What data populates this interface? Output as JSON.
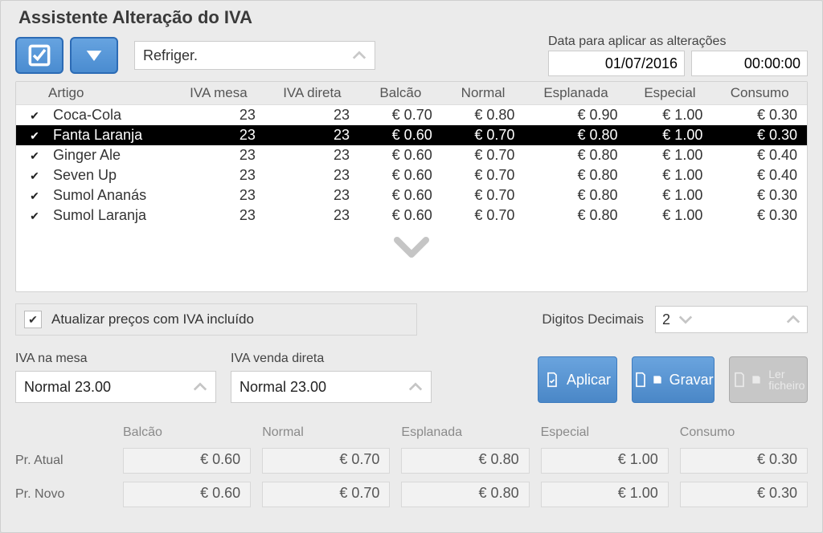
{
  "window": {
    "title": "Assistente Alteração do IVA"
  },
  "search": {
    "value": "Refriger."
  },
  "dateBlock": {
    "label": "Data para aplicar as alterações",
    "date": "01/07/2016",
    "time": "00:00:00"
  },
  "gridHeaders": {
    "artigo": "Artigo",
    "iva_mesa": "IVA mesa",
    "iva_direta": "IVA direta",
    "balcao": "Balcão",
    "normal": "Normal",
    "esplanada": "Esplanada",
    "especial": "Especial",
    "consumo": "Consumo"
  },
  "rows": [
    {
      "artigo": "Coca-Cola",
      "iva_mesa": "23",
      "iva_direta": "23",
      "balcao": "€ 0.70",
      "normal": "€ 0.80",
      "esplanada": "€ 0.90",
      "especial": "€ 1.00",
      "consumo": "€ 0.30"
    },
    {
      "artigo": "Fanta Laranja",
      "iva_mesa": "23",
      "iva_direta": "23",
      "balcao": "€ 0.60",
      "normal": "€ 0.70",
      "esplanada": "€ 0.80",
      "especial": "€ 1.00",
      "consumo": "€ 0.30"
    },
    {
      "artigo": "Ginger Ale",
      "iva_mesa": "23",
      "iva_direta": "23",
      "balcao": "€ 0.60",
      "normal": "€ 0.70",
      "esplanada": "€ 0.80",
      "especial": "€ 1.00",
      "consumo": "€ 0.40"
    },
    {
      "artigo": "Seven Up",
      "iva_mesa": "23",
      "iva_direta": "23",
      "balcao": "€ 0.60",
      "normal": "€ 0.70",
      "esplanada": "€ 0.80",
      "especial": "€ 1.00",
      "consumo": "€ 0.40"
    },
    {
      "artigo": "Sumol Ananás",
      "iva_mesa": "23",
      "iva_direta": "23",
      "balcao": "€ 0.60",
      "normal": "€ 0.70",
      "esplanada": "€ 0.80",
      "especial": "€ 1.00",
      "consumo": "€ 0.30"
    },
    {
      "artigo": "Sumol Laranja",
      "iva_mesa": "23",
      "iva_direta": "23",
      "balcao": "€ 0.60",
      "normal": "€ 0.70",
      "esplanada": "€ 0.80",
      "especial": "€ 1.00",
      "consumo": "€ 0.30"
    }
  ],
  "selectedRowIndex": 1,
  "options": {
    "updatePricesLabel": "Atualizar preços com IVA incluído",
    "decimalDigitsLabel": "Digitos Decimais",
    "decimalDigitsValue": "2"
  },
  "ivaMesa": {
    "label": "IVA na mesa",
    "value": "Normal 23.00"
  },
  "ivaDireta": {
    "label": "IVA venda direta",
    "value": "Normal 23.00"
  },
  "buttons": {
    "apply": "Aplicar",
    "save": "Gravar",
    "readFileTop": "Ler",
    "readFileBottom": "ficheiro"
  },
  "priceGrid": {
    "rowAtual": "Pr. Atual",
    "rowNovo": "Pr. Novo",
    "cols": {
      "balcao": "Balcão",
      "normal": "Normal",
      "esplanada": "Esplanada",
      "especial": "Especial",
      "consumo": "Consumo"
    },
    "atual": {
      "balcao": "€ 0.60",
      "normal": "€ 0.70",
      "esplanada": "€ 0.80",
      "especial": "€ 1.00",
      "consumo": "€ 0.30"
    },
    "novo": {
      "balcao": "€ 0.60",
      "normal": "€ 0.70",
      "esplanada": "€ 0.80",
      "especial": "€ 1.00",
      "consumo": "€ 0.30"
    }
  }
}
